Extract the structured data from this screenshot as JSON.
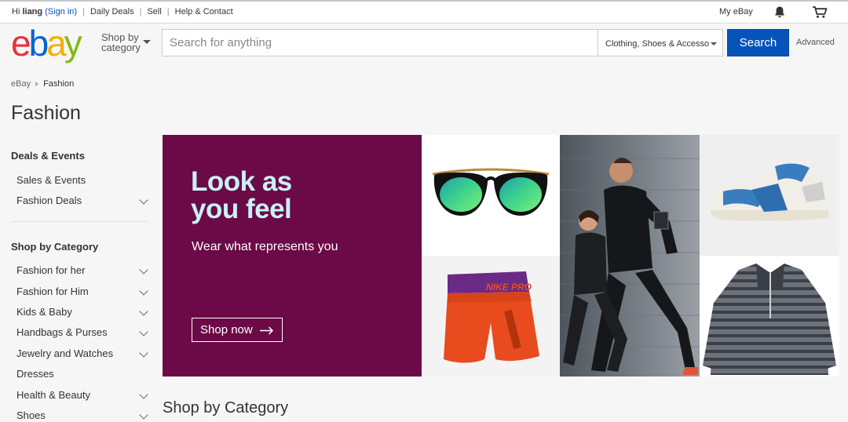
{
  "topbar": {
    "greeting_prefix": "Hi",
    "user_name": "liang",
    "sign_in": "(Sign in)",
    "daily_deals": "Daily Deals",
    "sell": "Sell",
    "help_contact": "Help & Contact",
    "my_ebay": "My eBay",
    "notification_icon": "bell-icon",
    "cart_icon": "cart-icon"
  },
  "header": {
    "logo_letters": [
      "e",
      "b",
      "a",
      "y"
    ],
    "logo_colors": [
      "#e53238",
      "#0064d2",
      "#f5af02",
      "#86b817"
    ],
    "shop_by_line1": "Shop by",
    "shop_by_line2": "category",
    "search_placeholder": "Search for anything",
    "category_selected": "Clothing, Shoes & Accesso",
    "search_button": "Search",
    "advanced": "Advanced",
    "accent_color": "#0654ba"
  },
  "breadcrumb": {
    "root": "eBay",
    "current": "Fashion"
  },
  "page_title": "Fashion",
  "sidebar": {
    "deals_heading": "Deals & Events",
    "deals_items": [
      {
        "label": "Sales & Events",
        "expandable": false
      },
      {
        "label": "Fashion Deals",
        "expandable": true
      }
    ],
    "category_heading": "Shop by Category",
    "category_items": [
      {
        "label": "Fashion for her",
        "expandable": true
      },
      {
        "label": "Fashion for Him",
        "expandable": true
      },
      {
        "label": "Kids & Baby",
        "expandable": true
      },
      {
        "label": "Handbags & Purses",
        "expandable": true
      },
      {
        "label": "Jewelry and Watches",
        "expandable": true
      },
      {
        "label": "Dresses",
        "expandable": false
      },
      {
        "label": "Health & Beauty",
        "expandable": true
      },
      {
        "label": "Shoes",
        "expandable": true
      }
    ]
  },
  "hero": {
    "headline": "Look as\nyou feel",
    "subline": "Wear what represents you",
    "cta": "Shop now",
    "background": "#6b0a47",
    "headline_color": "#c9f1f5",
    "shorts_brand_text": "NIKE PRO"
  },
  "sections": {
    "shop_by_category": "Shop by Category"
  }
}
